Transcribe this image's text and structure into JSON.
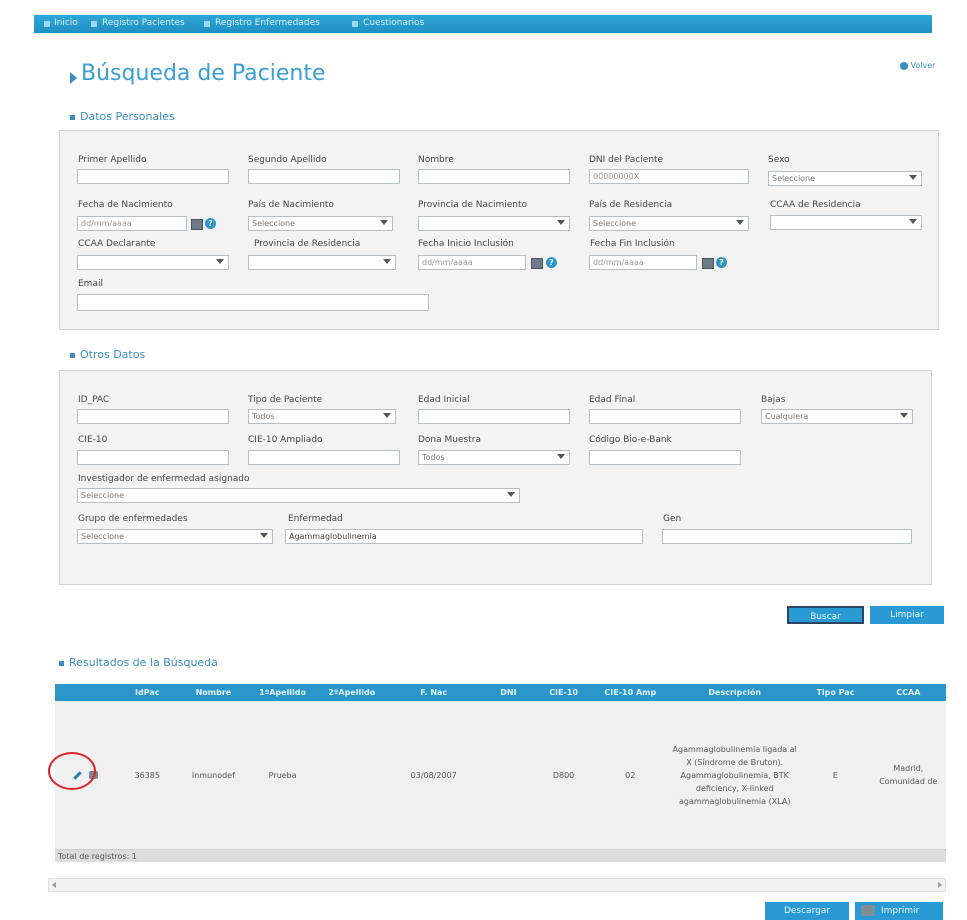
{
  "nav": {
    "items": [
      "Inicio",
      "Registro Pacientes",
      "Registro Enfermedades",
      "Cuestionarios"
    ]
  },
  "header": {
    "title": "Búsqueda de Paciente",
    "back_label": "Volver"
  },
  "datos_personales": {
    "title": "Datos Personales",
    "primer_apellido": {
      "label": "Primer Apellido",
      "value": ""
    },
    "segundo_apellido": {
      "label": "Segundo Apellido",
      "value": ""
    },
    "nombre": {
      "label": "Nombre",
      "value": ""
    },
    "dni": {
      "label": "DNI del Paciente",
      "placeholder": "00000000X"
    },
    "sexo": {
      "label": "Sexo",
      "value": "Seleccione"
    },
    "fecha_nacimiento": {
      "label": "Fecha de Nacimiento",
      "placeholder": "dd/mm/aaaa"
    },
    "pais_nacimiento": {
      "label": "País de Nacimiento",
      "value": "Seleccione"
    },
    "provincia_nacimiento": {
      "label": "Provincia de Nacimiento",
      "value": ""
    },
    "pais_residencia": {
      "label": "País de Residencia",
      "value": "Seleccione"
    },
    "ccaa_residencia": {
      "label": "CCAA de Residencia",
      "value": ""
    },
    "ccaa_declarante": {
      "label": "CCAA Declarante",
      "value": ""
    },
    "provincia_residencia": {
      "label": "Provincia de Residencia",
      "value": ""
    },
    "fecha_inicio": {
      "label": "Fecha Inicio Inclusión",
      "placeholder": "dd/mm/aaaa"
    },
    "fecha_fin": {
      "label": "Fecha Fin Inclusión",
      "placeholder": "dd/mm/aaaa"
    },
    "email": {
      "label": "Email",
      "value": ""
    }
  },
  "otros_datos": {
    "title": "Otros Datos",
    "id_pac": {
      "label": "ID_PAC",
      "value": ""
    },
    "tipo_paciente": {
      "label": "Tipo de Paciente",
      "value": "Todos"
    },
    "edad_inicial": {
      "label": "Edad Inicial",
      "value": ""
    },
    "edad_final": {
      "label": "Edad Final",
      "value": ""
    },
    "bajas": {
      "label": "Bajas",
      "value": "Cualquiera"
    },
    "cie10": {
      "label": "CIE-10",
      "value": ""
    },
    "cie10_ampliado": {
      "label": "CIE-10 Ampliado",
      "value": ""
    },
    "dona_muestra": {
      "label": "Dona Muestra",
      "value": "Todos"
    },
    "codigo_biobank": {
      "label": "Código Bio-e-Bank",
      "value": ""
    },
    "investigador": {
      "label": "Investigador de enfermedad asignado",
      "value": "Seleccione"
    },
    "grupo": {
      "label": "Grupo de enfermedades",
      "value": "Seleccione"
    },
    "enfermedad": {
      "label": "Enfermedad",
      "value": "Agammaglobulinemia"
    },
    "gen": {
      "label": "Gen",
      "value": ""
    }
  },
  "actions": {
    "buscar": "Buscar",
    "limpiar": "Limpiar"
  },
  "resultados": {
    "title": "Resultados de la Búsqueda",
    "columns": [
      "IdPac",
      "Nombre",
      "1ºApellido",
      "2ºApellido",
      "F. Nac",
      "DNI",
      "CIE-10",
      "CIE-10 Amp",
      "Descripción",
      "Tipo Pac",
      "CCAA"
    ],
    "rows": [
      {
        "idpac": "36385",
        "nombre": "Inmunodef",
        "apellido1": "Prueba",
        "apellido2": "",
        "fnac": "03/08/2007",
        "dni": "",
        "cie10": "D800",
        "cie10amp": "02",
        "descripcion": "Agammaglobulinemia ligada al X (Síndrome de Bruton). Agammaglobulinemia, BTK deficiency, X-linked agammaglobulinemia (XLA)",
        "tipo": "E",
        "ccaa": "Madrid, Comunidad de"
      }
    ],
    "total_label": "Total de registros: 1"
  },
  "footer": {
    "descargar": "Descargar",
    "imprimir": "Imprimir"
  },
  "colors": {
    "accent": "#2a96c9",
    "title": "#3a8fc0",
    "highlight_circle": "#d9262b"
  }
}
